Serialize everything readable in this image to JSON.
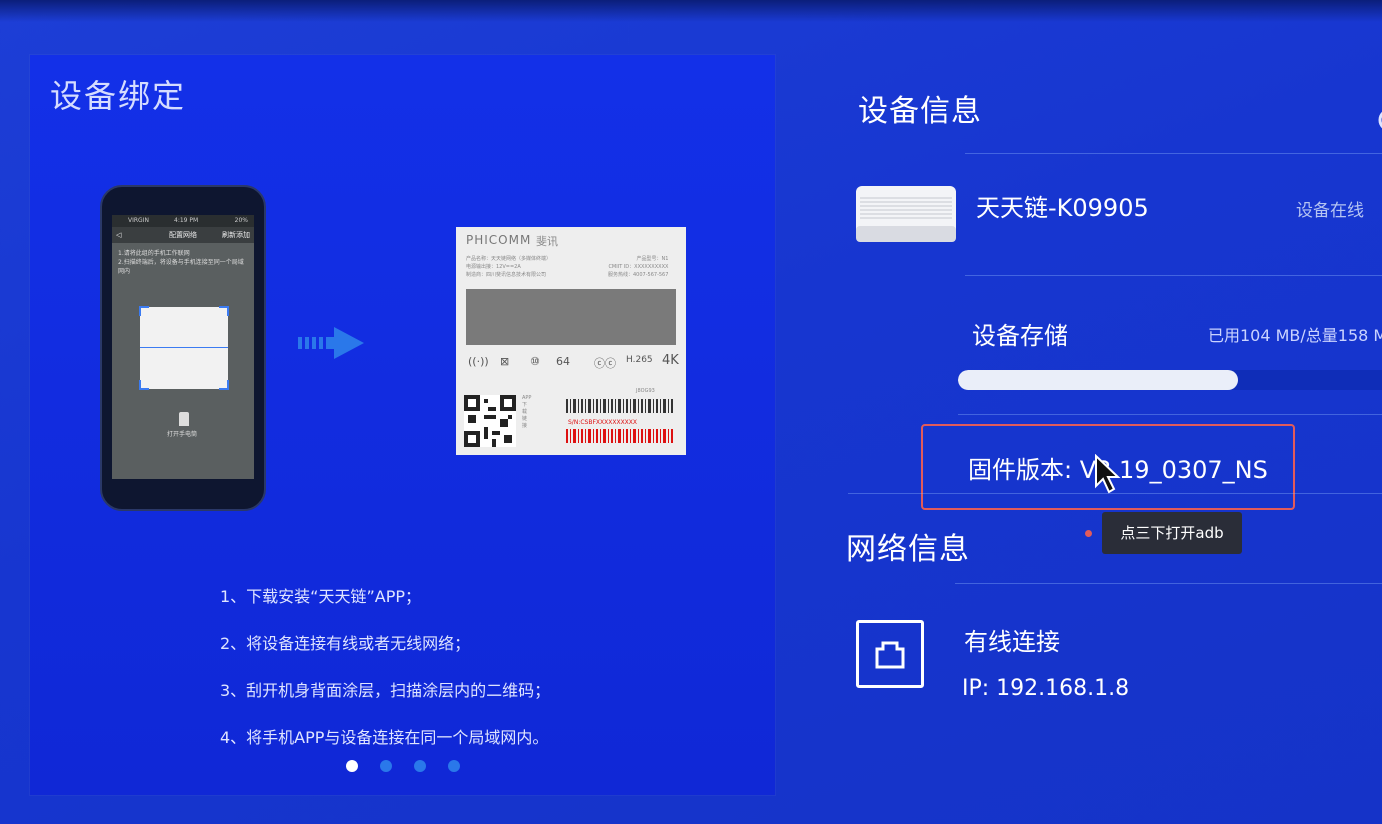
{
  "binding": {
    "title": "设备绑定",
    "steps": [
      "1、下载安装“天天链”APP；",
      "2、将设备连接有线或者无线网络；",
      "3、刮开机身背面涂层，扫描涂层内的二维码；",
      "4、将手机APP与设备连接在同一个局域网内。"
    ],
    "carousel": {
      "count": 4,
      "active_index": 0
    },
    "phone": {
      "carrier": "VIRGIN",
      "time": "4:19 PM",
      "battery": "20%",
      "screen_title": "配置网络",
      "back": "◁",
      "right_action": "刷新添加",
      "instructions": [
        "1.请将此组的手机工作联网",
        "2.扫描终端后，将设备与手机连接至同一个局域网内"
      ],
      "torch_label": "打开手电筒"
    },
    "label": {
      "brand": "PHICOMM",
      "brand_cn": "斐讯",
      "specs_left": [
        "产品名称：天天链网络（多媒体终端）",
        "电源输出接：12V==2A",
        "制造商：四川斐讯信息技术有限公司"
      ],
      "specs_right": [
        "产品型号：N1",
        "CMIIT ID：XXXXXXXXXX",
        "服务热线：4007-567-567"
      ],
      "storage_badge": "64",
      "codec_badge": "H.265",
      "resolution_badge": "4K",
      "side_text": "APP下载链接",
      "barcode_top": "J8OG93",
      "sn": "S/N:CSBFXXXXXXXXXX"
    }
  },
  "device_info": {
    "title": "设备信息",
    "device_name": "天天链-K09905",
    "status": "设备在线",
    "storage_title": "设备存储",
    "storage_used_text": "已用104 MB/总量158 M",
    "storage_fraction": 0.66,
    "firmware_label": "固件版本: V3.19_0307_NS",
    "tooltip": "点三下打开adb"
  },
  "network_info": {
    "title": "网络信息",
    "connection_type": "有线连接",
    "ip": "IP: 192.168.1.8"
  },
  "colors": {
    "background": "#1736d0",
    "panel": "#1330e8",
    "highlight_border": "#e25b5b",
    "dot_inactive": "#2a78ea"
  }
}
